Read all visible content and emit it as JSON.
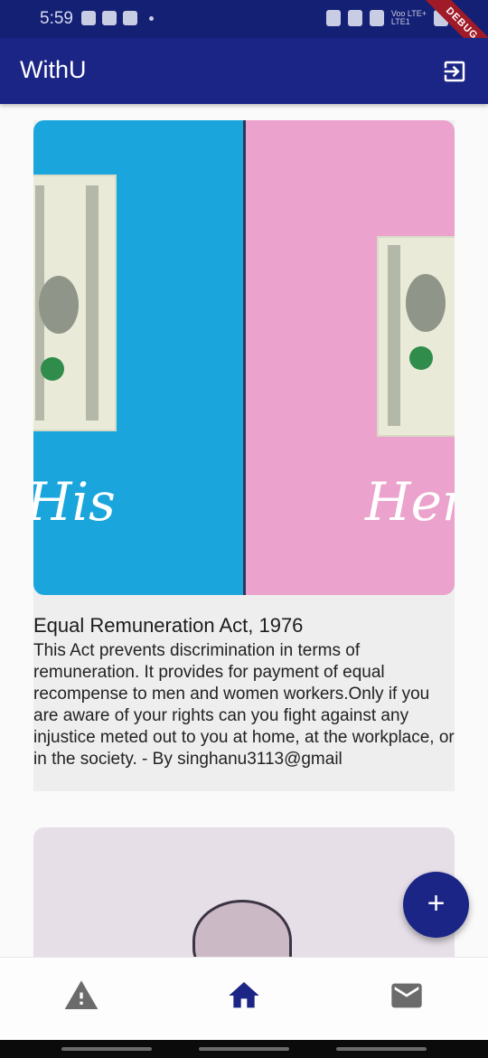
{
  "status_bar": {
    "time": "5:59",
    "network_line1": "Voo LTE+",
    "network_line2": "LTE1",
    "debug_label": "DEBUG"
  },
  "app_bar": {
    "title": "WithU",
    "logout_icon": "logout-icon"
  },
  "posts": [
    {
      "image_left_text": "His",
      "image_right_text": "Her",
      "title": "Equal Remuneration Act, 1976",
      "body": "This Act prevents discrimination in terms of remuneration. It provides for payment of equal recompense to men and women workers.Only if you are aware of your rights can you fight against any injustice meted out to you at home, at the workplace, or in the society. - By singhanu3113@gmail"
    }
  ],
  "fab": {
    "label": "+",
    "icon": "add-icon"
  },
  "bottom_nav": {
    "items": [
      {
        "icon": "warning-icon",
        "active": false
      },
      {
        "icon": "home-icon",
        "active": true
      },
      {
        "icon": "mail-icon",
        "active": false
      }
    ]
  },
  "colors": {
    "primary": "#1b2586",
    "status_bar": "#142074",
    "card_bg": "#eeeeee",
    "nav_inactive": "#6b6b6b"
  }
}
